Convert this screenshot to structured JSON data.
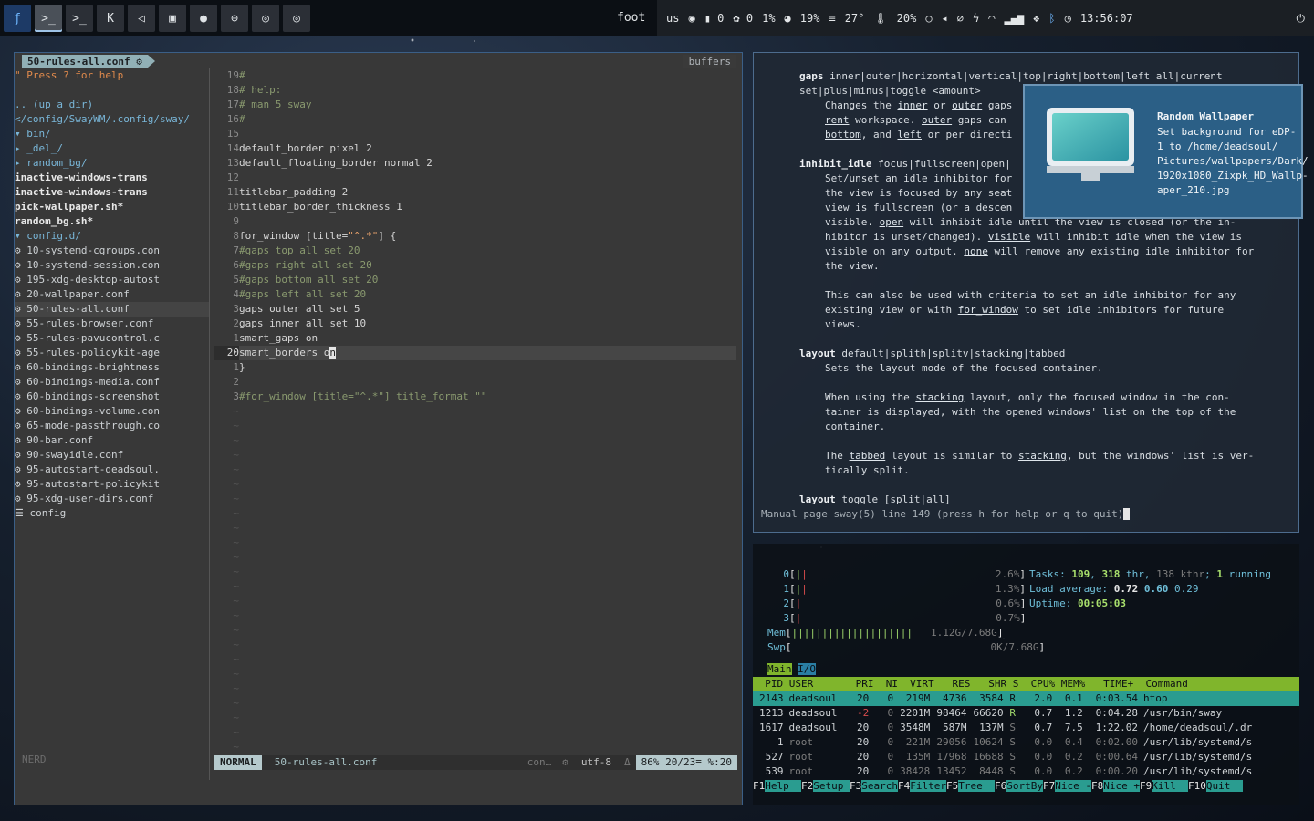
{
  "topbar": {
    "launcher_icon": "fedora-logo-icon",
    "buttons": [
      {
        "name": "terminal-workspace-1",
        "glyph": ">_"
      },
      {
        "name": "terminal-workspace-2",
        "glyph": ">_"
      },
      {
        "name": "kitty-workspace",
        "glyph": "K"
      },
      {
        "name": "vscode-workspace",
        "glyph": "◁"
      },
      {
        "name": "image-viewer-workspace",
        "glyph": "▣"
      },
      {
        "name": "chat-workspace",
        "glyph": "●"
      },
      {
        "name": "messages-workspace",
        "glyph": "⊖"
      },
      {
        "name": "chrome-workspace-1",
        "glyph": "◎"
      },
      {
        "name": "chrome-workspace-2",
        "glyph": "◎"
      }
    ],
    "window_title": "foot",
    "layout": "us",
    "clipboard_count": "0",
    "containers_count": "0",
    "cpu": "1%",
    "disk": "19%",
    "temp": "27°",
    "mem": "20%",
    "clock": "13:56:07"
  },
  "editor": {
    "buffer_tab": "50-rules-all.conf",
    "buffers_label": "buffers",
    "tree_hint": "\" Press ? for help",
    "tree": [
      {
        "text": "",
        "cls": ""
      },
      {
        "text": ".. (up a dir)",
        "cls": "dir"
      },
      {
        "text": "</config/SwayWM/.config/sway/",
        "cls": "dir"
      },
      {
        "text": "▾  bin/",
        "cls": "dir"
      },
      {
        "text": "  ▸  _del_/",
        "cls": "dir"
      },
      {
        "text": "  ▸  random_bg/",
        "cls": "dir"
      },
      {
        "text": "     inactive-windows-trans",
        "cls": "exe"
      },
      {
        "text": "     inactive-windows-trans",
        "cls": "exe"
      },
      {
        "text": "     pick-wallpaper.sh*",
        "cls": "exe"
      },
      {
        "text": "     random_bg.sh*",
        "cls": "exe"
      },
      {
        "text": "▾  config.d/",
        "cls": "dir"
      },
      {
        "text": "  ⚙  10-systemd-cgroups.con",
        "cls": ""
      },
      {
        "text": "  ⚙  10-systemd-session.con",
        "cls": ""
      },
      {
        "text": "  ⚙  195-xdg-desktop-autost",
        "cls": ""
      },
      {
        "text": "  ⚙  20-wallpaper.conf",
        "cls": ""
      },
      {
        "text": "  ⚙  50-rules-all.conf",
        "cls": "sel"
      },
      {
        "text": "  ⚙  55-rules-browser.conf",
        "cls": ""
      },
      {
        "text": "  ⚙  55-rules-pavucontrol.c",
        "cls": ""
      },
      {
        "text": "  ⚙  55-rules-policykit-age",
        "cls": ""
      },
      {
        "text": "  ⚙  60-bindings-brightness",
        "cls": ""
      },
      {
        "text": "  ⚙  60-bindings-media.conf",
        "cls": ""
      },
      {
        "text": "  ⚙  60-bindings-screenshot",
        "cls": ""
      },
      {
        "text": "  ⚙  60-bindings-volume.con",
        "cls": ""
      },
      {
        "text": "  ⚙  65-mode-passthrough.co",
        "cls": ""
      },
      {
        "text": "  ⚙  90-bar.conf",
        "cls": ""
      },
      {
        "text": "  ⚙  90-swayidle.conf",
        "cls": ""
      },
      {
        "text": "  ⚙  95-autostart-deadsoul.",
        "cls": ""
      },
      {
        "text": "  ⚙  95-autostart-policykit",
        "cls": ""
      },
      {
        "text": "  ⚙  95-xdg-user-dirs.conf",
        "cls": ""
      },
      {
        "text": "  ☰  config",
        "cls": ""
      }
    ],
    "gutter": [
      "19",
      "18",
      "17",
      "16",
      "15",
      "14",
      "13",
      "12",
      "11",
      "10",
      "9",
      "8",
      "7",
      "6",
      "5",
      "4",
      "3",
      "2",
      "1",
      "20",
      "1",
      "2",
      "3"
    ],
    "code": [
      {
        "t": "#",
        "c": "comment"
      },
      {
        "t": "# help:",
        "c": "comment"
      },
      {
        "t": "#   man 5 sway",
        "c": "comment"
      },
      {
        "t": "#",
        "c": "comment"
      },
      {
        "t": "",
        "c": ""
      },
      {
        "t": "default_border pixel 2",
        "c": ""
      },
      {
        "t": "default_floating_border normal 2",
        "c": ""
      },
      {
        "t": "",
        "c": ""
      },
      {
        "t": "titlebar_padding 2",
        "c": ""
      },
      {
        "t": "titlebar_border_thickness 1",
        "c": ""
      },
      {
        "t": "",
        "c": ""
      },
      {
        "t": "for_window [title=\"^.*\"] {",
        "c": "fw"
      },
      {
        "t": "    #gaps top all set 20",
        "c": "comment"
      },
      {
        "t": "    #gaps right all set 20",
        "c": "comment"
      },
      {
        "t": "    #gaps bottom all set 20",
        "c": "comment"
      },
      {
        "t": "    #gaps left all set 20",
        "c": "comment"
      },
      {
        "t": "    gaps outer all set 5",
        "c": ""
      },
      {
        "t": "    gaps inner all set 10",
        "c": ""
      },
      {
        "t": "    smart_gaps on",
        "c": ""
      },
      {
        "t": "    smart_borders o",
        "c": "cur"
      },
      {
        "t": "}",
        "c": ""
      },
      {
        "t": "",
        "c": ""
      },
      {
        "t": "#for_window [title=\"^.*\"] title_format \"\"",
        "c": "comment"
      }
    ],
    "nerd_label": "NERD",
    "mode": "NORMAL",
    "status_file": "50-rules-all.conf",
    "status_conf": "con…",
    "encoding": "utf-8",
    "position": "86% 20/23≡ %:20"
  },
  "man": {
    "status": "Manual page sway(5) line 149 (press h for help or q to quit)"
  },
  "notification": {
    "title": "Random Wallpaper",
    "body": "Set background for eDP-1 to /home/deadsoul/ Pictures/wallpapers/Dark/ 1920x1080_Zixpk_HD_Wallp- aper_210.jpg"
  },
  "htop": {
    "cpus": [
      {
        "id": "0",
        "pct": "2.6%"
      },
      {
        "id": "1",
        "pct": "1.3%"
      },
      {
        "id": "2",
        "pct": "0.6%"
      },
      {
        "id": "3",
        "pct": "0.7%"
      }
    ],
    "mem": "1.12G/7.68G",
    "swp": "0K/7.68G",
    "tasks": "109",
    "thr": "318",
    "kthr": "138",
    "running": "1",
    "load1": "0.72",
    "load5": "0.60",
    "load15": "0.29",
    "uptime": "00:05:03",
    "tab_main": "Main",
    "tab_io": "I/O",
    "header": "  PID USER       PRI  NI  VIRT   RES   SHR S  CPU% MEM%   TIME+  Command",
    "processes": [
      {
        "pid": "2143",
        "user": "deadsoul",
        "pri": "20",
        "ni": "0",
        "virt": "219M",
        "res": "4736",
        "shr": "3584",
        "s": "R",
        "cpu": "2.0",
        "mem": "0.1",
        "time": "0:03.54",
        "cmd": "htop"
      },
      {
        "pid": "1213",
        "user": "deadsoul",
        "pri": "-2",
        "ni": "0",
        "virt": "2201M",
        "res": "98464",
        "shr": "66620",
        "s": "R",
        "cpu": "0.7",
        "mem": "1.2",
        "time": "0:04.28",
        "cmd": "/usr/bin/sway"
      },
      {
        "pid": "1617",
        "user": "deadsoul",
        "pri": "20",
        "ni": "0",
        "virt": "3548M",
        "res": "587M",
        "shr": "137M",
        "s": "S",
        "cpu": "0.7",
        "mem": "7.5",
        "time": "1:22.02",
        "cmd": "/home/deadsoul/.dr"
      },
      {
        "pid": "1",
        "user": "root",
        "pri": "20",
        "ni": "0",
        "virt": "221M",
        "res": "29056",
        "shr": "10624",
        "s": "S",
        "cpu": "0.0",
        "mem": "0.4",
        "time": "0:02.00",
        "cmd": "/usr/lib/systemd/s"
      },
      {
        "pid": "527",
        "user": "root",
        "pri": "20",
        "ni": "0",
        "virt": "135M",
        "res": "17968",
        "shr": "16688",
        "s": "S",
        "cpu": "0.0",
        "mem": "0.2",
        "time": "0:00.64",
        "cmd": "/usr/lib/systemd/s"
      },
      {
        "pid": "539",
        "user": "root",
        "pri": "20",
        "ni": "0",
        "virt": "38428",
        "res": "13452",
        "shr": "8448",
        "s": "S",
        "cpu": "0.0",
        "mem": "0.2",
        "time": "0:00.20",
        "cmd": "/usr/lib/systemd/s"
      }
    ],
    "fkeys": [
      {
        "k": "F1",
        "l": "Help  "
      },
      {
        "k": "F2",
        "l": "Setup "
      },
      {
        "k": "F3",
        "l": "Search"
      },
      {
        "k": "F4",
        "l": "Filter"
      },
      {
        "k": "F5",
        "l": "Tree  "
      },
      {
        "k": "F6",
        "l": "SortBy"
      },
      {
        "k": "F7",
        "l": "Nice -"
      },
      {
        "k": "F8",
        "l": "Nice +"
      },
      {
        "k": "F9",
        "l": "Kill  "
      },
      {
        "k": "F10",
        "l": "Quit  "
      }
    ]
  }
}
